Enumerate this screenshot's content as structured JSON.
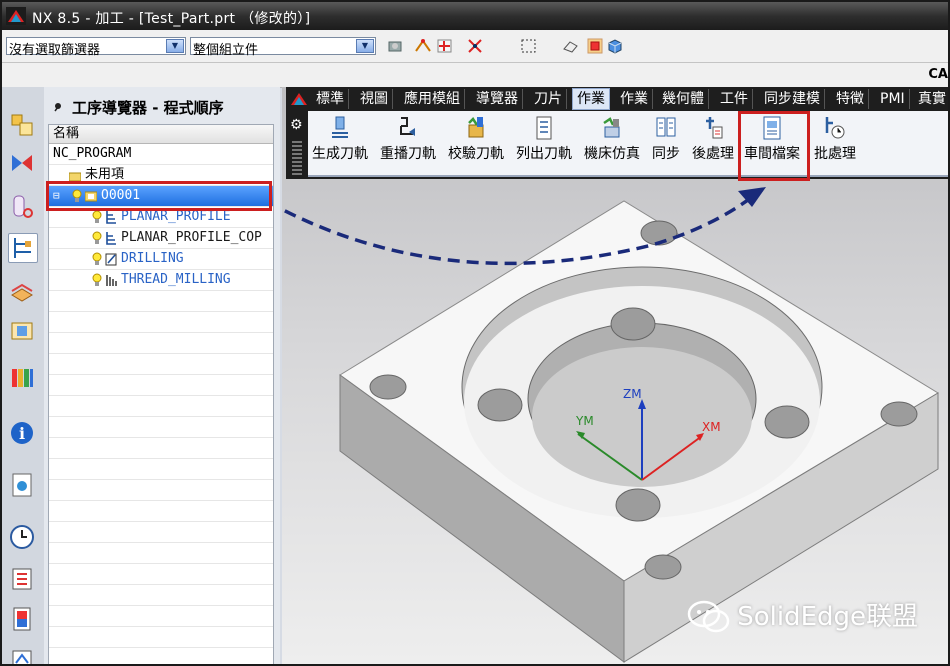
{
  "window": {
    "title": "NX 8.5 - 加工 - [Test_Part.prt （修改的）]"
  },
  "toolbar": {
    "filter_combo": "沒有選取篩選器",
    "scope_combo": "整個組立件",
    "right_label": "CA"
  },
  "navigator": {
    "title": "工序導覽器 - 程式順序",
    "column_header": "名稱",
    "rows": [
      {
        "label": "NC_PROGRAM"
      },
      {
        "label": "未用項"
      },
      {
        "label": "O0001"
      },
      {
        "label": "PLANAR_PROFILE"
      },
      {
        "label": "PLANAR_PROFILE_COP"
      },
      {
        "label": "DRILLING"
      },
      {
        "label": "THREAD_MILLING"
      }
    ]
  },
  "ribbon": {
    "tabs": [
      {
        "label": "標準"
      },
      {
        "label": "視圖"
      },
      {
        "label": "應用模組"
      },
      {
        "label": "導覽器"
      },
      {
        "label": "刀片"
      },
      {
        "label": "作業"
      },
      {
        "label": "作業"
      },
      {
        "label": "幾何體"
      },
      {
        "label": "工件"
      },
      {
        "label": "同步建模"
      },
      {
        "label": "特徵"
      },
      {
        "label": "PMI"
      },
      {
        "label": "真實"
      }
    ],
    "active_tab_index": 5,
    "buttons": [
      {
        "label": "生成刀軌",
        "icon": "generate-toolpath-icon"
      },
      {
        "label": "重播刀軌",
        "icon": "replay-toolpath-icon"
      },
      {
        "label": "校驗刀軌",
        "icon": "verify-toolpath-icon"
      },
      {
        "label": "列出刀軌",
        "icon": "list-toolpath-icon"
      },
      {
        "label": "機床仿真",
        "icon": "machine-simulation-icon"
      },
      {
        "label": "同步",
        "icon": "synchronize-icon"
      },
      {
        "label": "後處理",
        "icon": "postprocess-icon"
      },
      {
        "label": "車間檔案",
        "icon": "shop-documentation-icon"
      },
      {
        "label": "批處理",
        "icon": "batch-process-icon"
      }
    ]
  },
  "viewport": {
    "axes": {
      "z": "ZM",
      "y": "YM",
      "x": "XM"
    },
    "watermark": "SolidEdge联盟"
  },
  "colors": {
    "highlight": "#cc1f1f",
    "arrow": "#1a2a7a",
    "selection": "#2f7ff0"
  }
}
